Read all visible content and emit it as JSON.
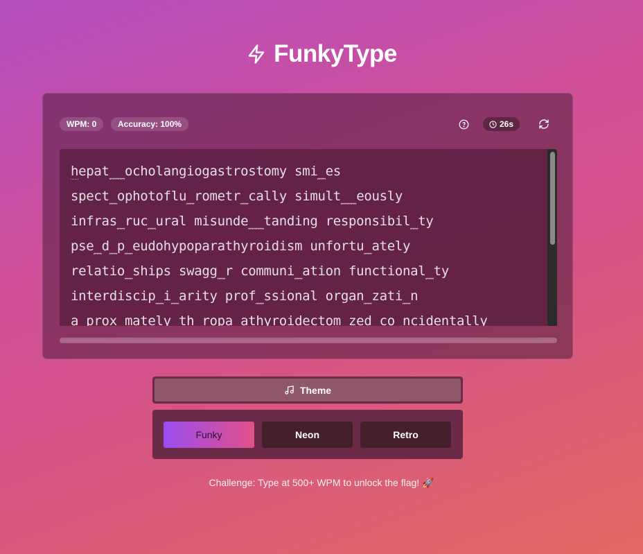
{
  "app": {
    "title": "FunkyType"
  },
  "stats": {
    "wpm": "WPM: 0",
    "accuracy": "Accuracy: 100%",
    "timer": "26s"
  },
  "icons": {
    "title": "lightning-bolt-icon",
    "help": "help-circle-icon",
    "timer": "clock-icon",
    "refresh": "refresh-icon",
    "theme": "music-note-icon"
  },
  "typing": {
    "lines": [
      [
        {
          "t": "h",
          "c": "cursor"
        },
        {
          "t": "epat"
        },
        {
          "t": "__",
          "c": "ul"
        },
        {
          "t": "ocholangiogastrostomy smi"
        },
        {
          "t": "_",
          "c": "ul"
        },
        {
          "t": "es"
        }
      ],
      [
        {
          "t": "spect"
        },
        {
          "t": "_",
          "c": "ul"
        },
        {
          "t": "ophotoflu"
        },
        {
          "t": "_",
          "c": "ul"
        },
        {
          "t": "rometr"
        },
        {
          "t": "_",
          "c": "ul"
        },
        {
          "t": "cally simult"
        },
        {
          "t": "__",
          "c": "ul"
        },
        {
          "t": "eously"
        }
      ],
      [
        {
          "t": "infras"
        },
        {
          "t": "_",
          "c": "ul"
        },
        {
          "t": "ruc"
        },
        {
          "t": "_",
          "c": "ul"
        },
        {
          "t": "ural misunde"
        },
        {
          "t": "__",
          "c": "ul"
        },
        {
          "t": "tanding responsibil"
        },
        {
          "t": "_",
          "c": "ul"
        },
        {
          "t": "ty"
        }
      ],
      [
        {
          "t": "pse"
        },
        {
          "t": "_",
          "c": "ul"
        },
        {
          "t": "d"
        },
        {
          "t": "_",
          "c": "ul"
        },
        {
          "t": "p"
        },
        {
          "t": "_",
          "c": "ul"
        },
        {
          "t": "eudohypoparathyroidism unfortu"
        },
        {
          "t": "_",
          "c": "ul"
        },
        {
          "t": "ately"
        }
      ],
      [
        {
          "t": "relatio"
        },
        {
          "t": "_",
          "c": "ul"
        },
        {
          "t": "ships swagg"
        },
        {
          "t": "_",
          "c": "ul"
        },
        {
          "t": "r communi"
        },
        {
          "t": "_",
          "c": "ul"
        },
        {
          "t": "ation functional"
        },
        {
          "t": "_",
          "c": "ul"
        },
        {
          "t": "ty"
        }
      ],
      [
        {
          "t": "interdiscip"
        },
        {
          "t": "_",
          "c": "ul"
        },
        {
          "t": "i"
        },
        {
          "t": "_",
          "c": "ul"
        },
        {
          "t": "arity prof"
        },
        {
          "t": "_",
          "c": "ul"
        },
        {
          "t": "ssional organ"
        },
        {
          "t": "_",
          "c": "ul"
        },
        {
          "t": "zati"
        },
        {
          "t": "_",
          "c": "ul"
        },
        {
          "t": "n"
        }
      ],
      [
        {
          "t": "a"
        },
        {
          "t": "_",
          "c": "ul"
        },
        {
          "t": "prox"
        },
        {
          "t": "_",
          "c": "ul"
        },
        {
          "t": "mately th"
        },
        {
          "t": "_",
          "c": "ul"
        },
        {
          "t": "ropa"
        },
        {
          "t": "_",
          "c": "ul"
        },
        {
          "t": "athyroidectom"
        },
        {
          "t": "_",
          "c": "ul"
        },
        {
          "t": "zed co"
        },
        {
          "t": "_",
          "c": "ul"
        },
        {
          "t": "ncidentally"
        }
      ]
    ]
  },
  "theme": {
    "toggle_label": "Theme",
    "options": [
      "Funky",
      "Neon",
      "Retro"
    ],
    "selected": "Funky"
  },
  "footer": {
    "challenge": "Challenge: Type at 500+ WPM to unlock the flag! 🚀"
  }
}
